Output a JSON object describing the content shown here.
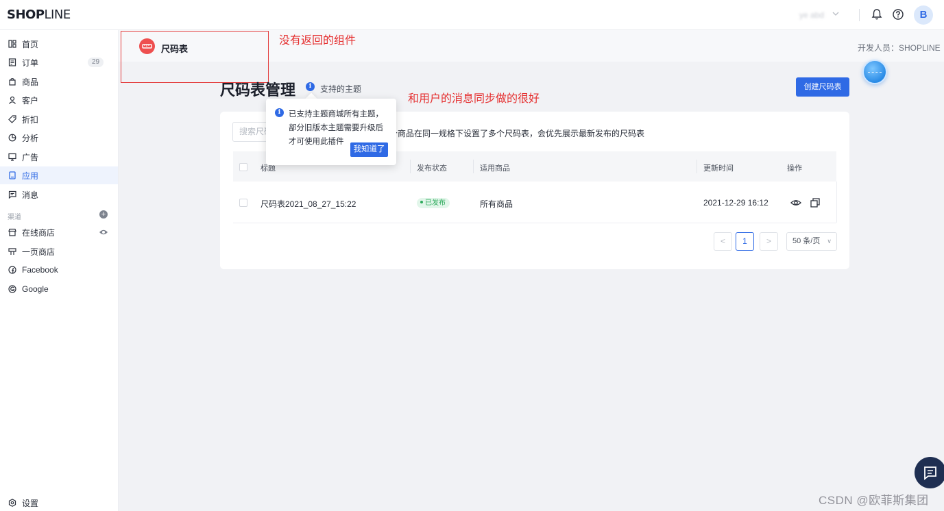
{
  "header": {
    "logo_bold": "SHOP",
    "logo_light": "LINE",
    "user_name": "ye abd",
    "avatar_letter": "B"
  },
  "sidebar": {
    "items": [
      {
        "label": "首页",
        "icon": "home-icon"
      },
      {
        "label": "订单",
        "icon": "order-icon",
        "badge": "29"
      },
      {
        "label": "商品",
        "icon": "product-icon"
      },
      {
        "label": "客户",
        "icon": "customer-icon"
      },
      {
        "label": "折扣",
        "icon": "discount-tag-icon"
      },
      {
        "label": "分析",
        "icon": "analytics-icon"
      },
      {
        "label": "广告",
        "icon": "ads-icon"
      },
      {
        "label": "应用",
        "icon": "apps-icon",
        "active": true
      },
      {
        "label": "消息",
        "icon": "message-icon"
      }
    ],
    "section_label": "渠道",
    "channels": [
      {
        "label": "在线商店",
        "icon": "online-store-icon"
      },
      {
        "label": "一页商店",
        "icon": "one-page-store-icon"
      },
      {
        "label": "Facebook",
        "icon": "facebook-icon"
      },
      {
        "label": "Google",
        "icon": "google-icon"
      }
    ],
    "settings_label": "设置"
  },
  "app": {
    "name": "尺码表",
    "developer": "开发人员：SHOPLINE"
  },
  "annotations": {
    "no_back": "没有返回的组件",
    "sync": "和用户的消息同步做的很好"
  },
  "page": {
    "title": "尺码表管理",
    "themes_link": "支持的主题",
    "create_button": "创建尺码表",
    "search_placeholder": "搜索尺码",
    "hint": "个商品在同一规格下设置了多个尺码表，会优先展示最新发布的尺码表"
  },
  "table": {
    "headers": {
      "title": "标题",
      "status": "发布状态",
      "products": "适用商品",
      "updated": "更新时间",
      "actions": "操作"
    },
    "rows": [
      {
        "title": "尺码表2021_08_27_15:22",
        "status": "已发布",
        "products": "所有商品",
        "updated": "2021-12-29 16:12"
      }
    ]
  },
  "pagination": {
    "prev": "<",
    "current": "1",
    "next": ">",
    "page_size": "50 条/页"
  },
  "popover": {
    "text": "已支持主题商城所有主题，部分旧版本主题需要升级后才可使用此插件",
    "button": "我知道了"
  },
  "watermark": "CSDN @欧菲斯集团",
  "colors": {
    "primary": "#2f6ae5",
    "annotation": "#e52f2f",
    "success": "#2eaa5c"
  }
}
